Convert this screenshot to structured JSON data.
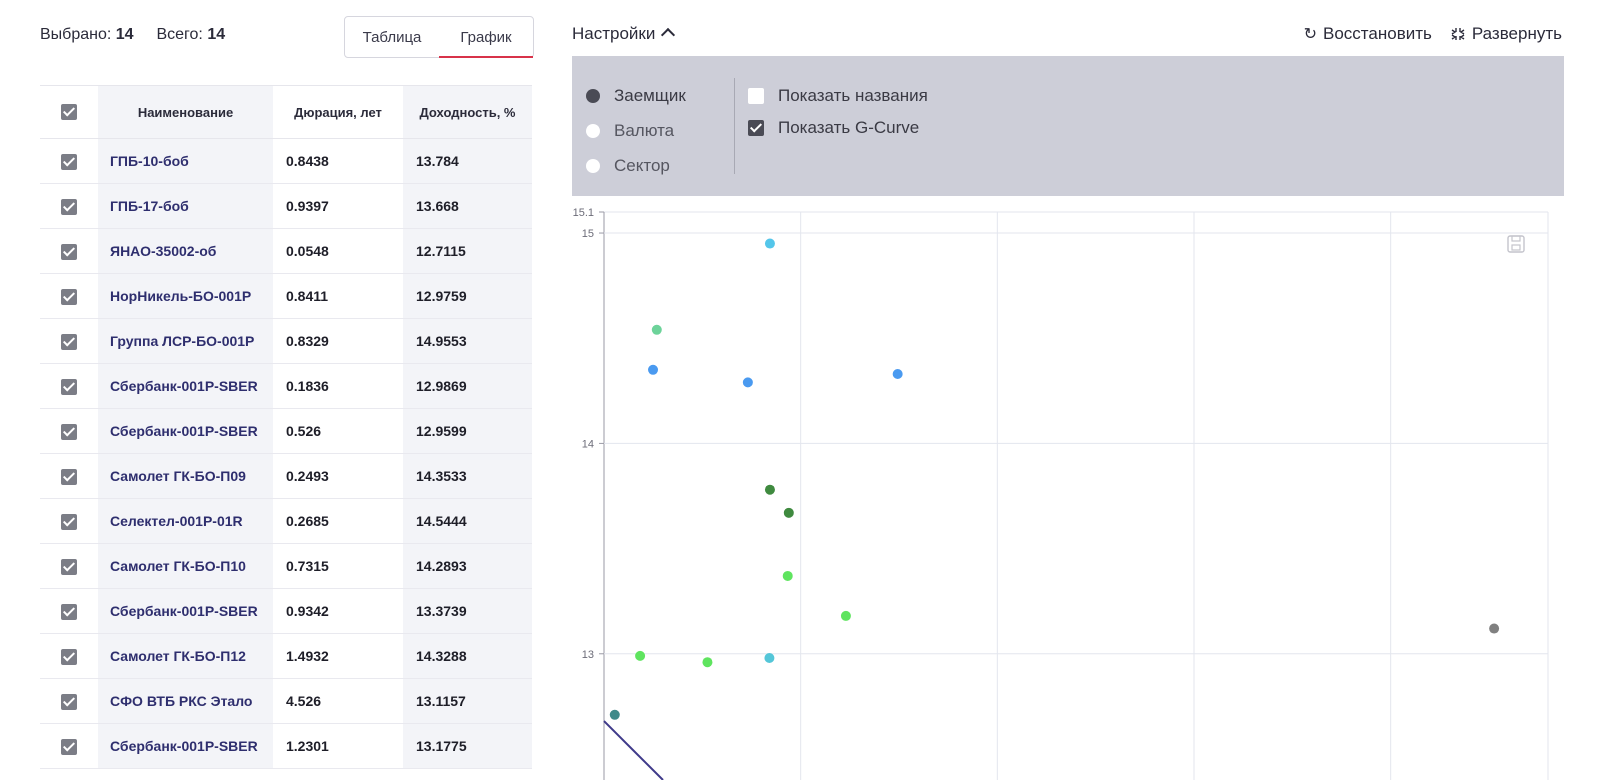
{
  "header": {
    "selected_label": "Выбрано:",
    "selected_value": "14",
    "total_label": "Всего:",
    "total_value": "14"
  },
  "view_tabs": [
    {
      "label": "Таблица",
      "active": false
    },
    {
      "label": "График",
      "active": true
    }
  ],
  "table": {
    "columns": [
      "Наименование",
      "Дюрация, лет",
      "Доходность, %"
    ],
    "rows": [
      {
        "name": "ГПБ-10-боб",
        "duration": "0.8438",
        "yield": "13.784"
      },
      {
        "name": "ГПБ-17-боб",
        "duration": "0.9397",
        "yield": "13.668"
      },
      {
        "name": "ЯНАО-35002-об",
        "duration": "0.0548",
        "yield": "12.7115"
      },
      {
        "name": "НорНикель-БО-001Р",
        "duration": "0.8411",
        "yield": "12.9759"
      },
      {
        "name": "Группа ЛСР-БО-001Р",
        "duration": "0.8329",
        "yield": "14.9553"
      },
      {
        "name": "Сбербанк-001Р-SBER",
        "duration": "0.1836",
        "yield": "12.9869"
      },
      {
        "name": "Сбербанк-001Р-SBER",
        "duration": "0.526",
        "yield": "12.9599"
      },
      {
        "name": "Самолет ГК-БО-П09",
        "duration": "0.2493",
        "yield": "14.3533"
      },
      {
        "name": "Селектел-001Р-01R",
        "duration": "0.2685",
        "yield": "14.5444"
      },
      {
        "name": "Самолет ГК-БО-П10",
        "duration": "0.7315",
        "yield": "14.2893"
      },
      {
        "name": "Сбербанк-001Р-SBER",
        "duration": "0.9342",
        "yield": "13.3739"
      },
      {
        "name": "Самолет ГК-БО-П12",
        "duration": "1.4932",
        "yield": "14.3288"
      },
      {
        "name": "СФО ВТБ РКС Этало",
        "duration": "4.526",
        "yield": "13.1157"
      },
      {
        "name": "Сбербанк-001Р-SBER",
        "duration": "1.2301",
        "yield": "13.1775"
      }
    ]
  },
  "settings": {
    "title": "Настройки",
    "restore_label": "Восстановить",
    "expand_label": "Развернуть",
    "group_by": [
      {
        "label": "Заемщик",
        "selected": true
      },
      {
        "label": "Валюта",
        "selected": false
      },
      {
        "label": "Сектор",
        "selected": false
      }
    ],
    "options": [
      {
        "label": "Показать названия",
        "checked": false
      },
      {
        "label": "Показать G-Curve",
        "checked": true
      }
    ]
  },
  "icons": {
    "restore": "refresh-icon",
    "expand": "collapse-arrows-icon",
    "settings_toggle": "chevron-up-icon",
    "save_chart": "save-icon"
  },
  "colors": {
    "tab_active_underline": "#d8334a",
    "settings_bg": "#cdced8",
    "name_text": "#2e2e6e",
    "gcurve": "#3f3a8a"
  },
  "chart_data": {
    "type": "scatter",
    "yticks": [
      "15.1",
      "15",
      "14",
      "13"
    ],
    "ylim": [
      12.4,
      15.1
    ],
    "xlim": [
      0,
      4.8
    ],
    "points": [
      {
        "x": 0.8438,
        "y": 14.95,
        "color": "#54c6ea"
      },
      {
        "x": 0.2685,
        "y": 14.54,
        "color": "#6dd39a"
      },
      {
        "x": 0.2493,
        "y": 14.35,
        "color": "#4a9af0"
      },
      {
        "x": 0.7315,
        "y": 14.29,
        "color": "#4a9af0"
      },
      {
        "x": 1.4932,
        "y": 14.33,
        "color": "#4a9af0"
      },
      {
        "x": 0.8438,
        "y": 13.78,
        "color": "#3f8a3f"
      },
      {
        "x": 0.9397,
        "y": 13.67,
        "color": "#3f8a3f"
      },
      {
        "x": 0.9342,
        "y": 13.37,
        "color": "#5fe45f"
      },
      {
        "x": 1.2301,
        "y": 13.18,
        "color": "#5fe45f"
      },
      {
        "x": 0.1836,
        "y": 12.99,
        "color": "#5fe45f"
      },
      {
        "x": 0.526,
        "y": 12.96,
        "color": "#5fe45f"
      },
      {
        "x": 0.8411,
        "y": 12.98,
        "color": "#54c6d8"
      },
      {
        "x": 4.526,
        "y": 13.12,
        "color": "#808080"
      },
      {
        "x": 0.0548,
        "y": 12.71,
        "color": "#3f8a8a"
      }
    ],
    "gcurve": {
      "name": "G-Curve",
      "x": [
        0,
        0.3
      ],
      "y": [
        12.68,
        12.4
      ]
    }
  }
}
